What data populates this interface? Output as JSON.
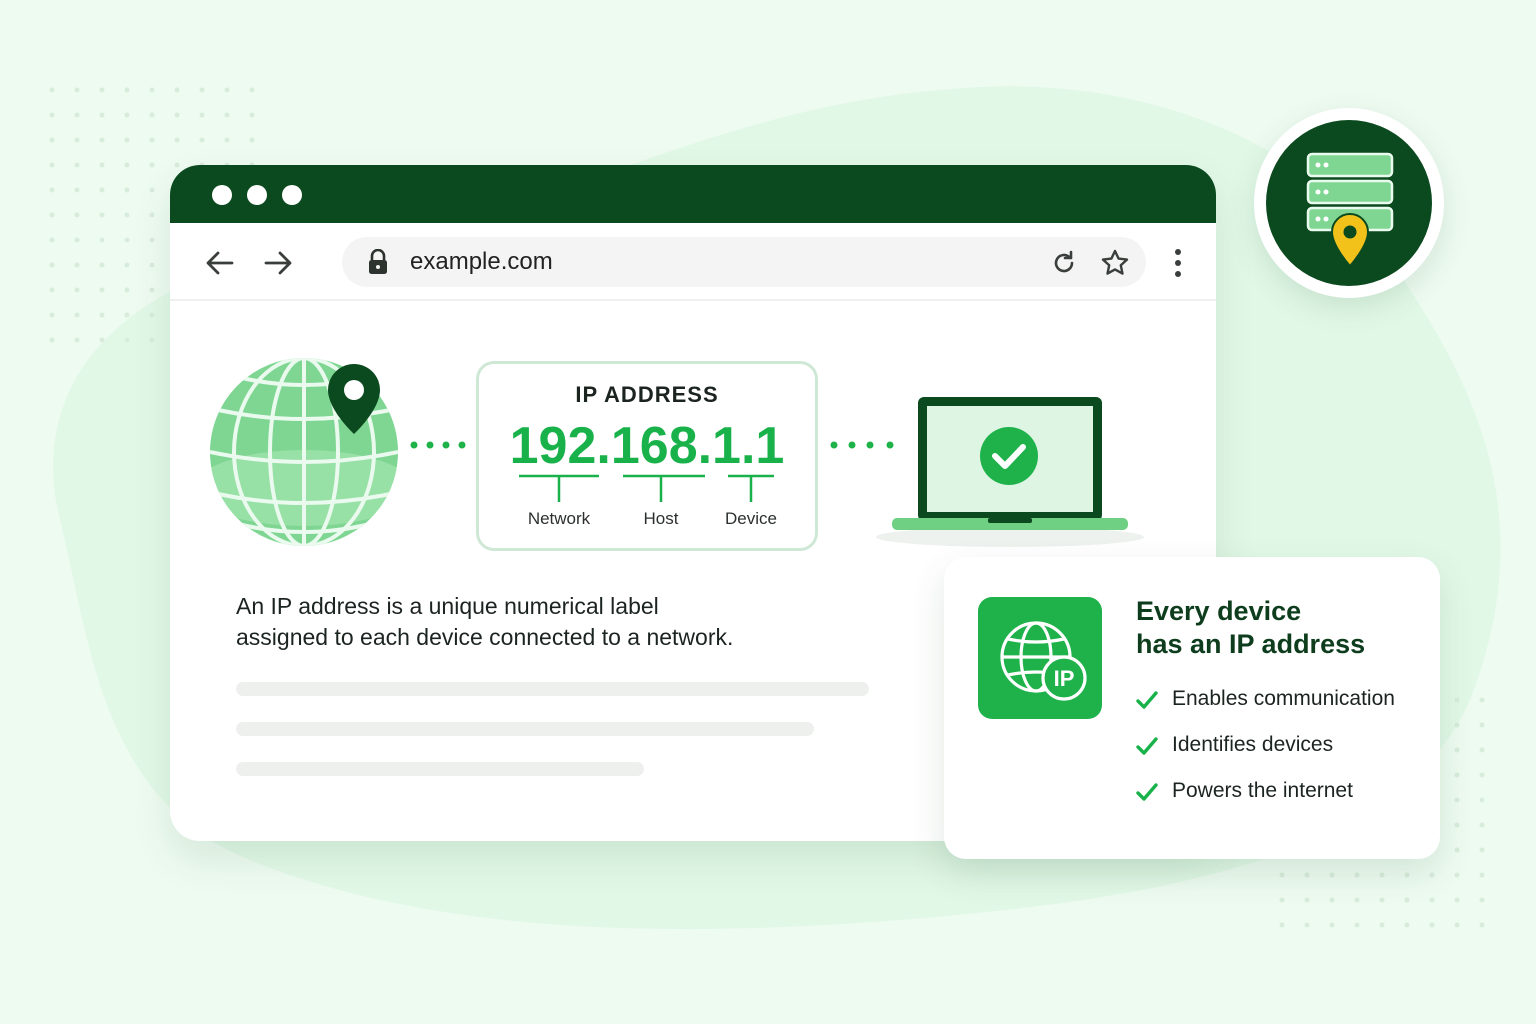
{
  "colors": {
    "background": "#eefbf1",
    "dark_green": "#0b4a1f",
    "accent_green": "#19b24a",
    "light_green": "#8fdc9f",
    "pin_yellow": "#f2c21b"
  },
  "browser": {
    "window_controls": [
      "dot",
      "dot",
      "dot"
    ],
    "nav": {
      "back_icon": "arrow-left-icon",
      "forward_icon": "arrow-right-icon"
    },
    "address_bar": {
      "secure_icon": "lock-icon",
      "url": "example.com",
      "reload_icon": "reload-icon",
      "bookmark_icon": "star-icon"
    },
    "menu_icon": "kebab-menu-icon"
  },
  "diagram": {
    "globe_icon": "globe-with-pin-icon",
    "ip_card": {
      "label": "IP ADDRESS",
      "value": "192.168.1.1",
      "segments": [
        "Network",
        "Host",
        "Device"
      ]
    },
    "device_icon": "laptop-check-icon"
  },
  "description": {
    "line1": "An IP address is a unique numerical label",
    "line2": "assigned to each device connected to a network."
  },
  "server_badge": {
    "icon": "server-location-icon"
  },
  "info_card": {
    "tile_icon": "globe-ip-icon",
    "tile_text": "IP",
    "title_line1": "Every device",
    "title_line2": "has an IP address",
    "features": [
      "Enables communication",
      "Identifies devices",
      "Powers the internet"
    ]
  }
}
